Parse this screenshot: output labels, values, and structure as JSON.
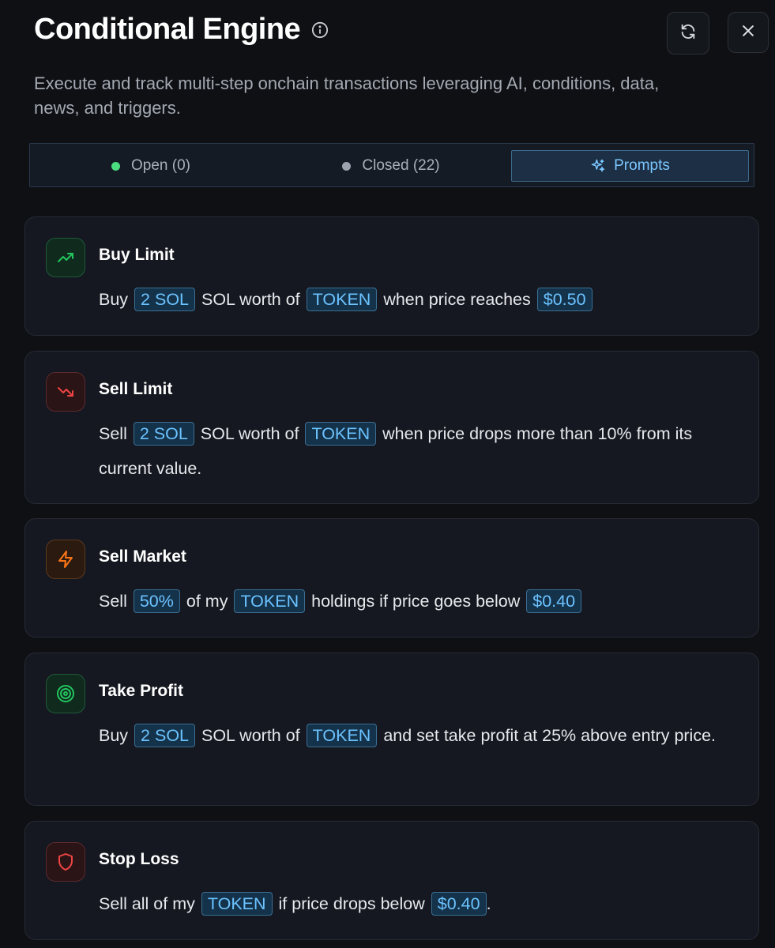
{
  "header": {
    "title": "Conditional Engine",
    "subtitle": "Execute and track multi-step onchain transactions leveraging AI, conditions, data, news, and triggers."
  },
  "tabs": {
    "open": {
      "label": "Open (0)",
      "dot_color": "#4ade80"
    },
    "closed": {
      "label": "Closed (22)",
      "dot_color": "#9ca3af"
    },
    "prompts": {
      "label": "Prompts"
    }
  },
  "colors": {
    "accent": "#6cc3ff",
    "green": "#22c55e",
    "red": "#ef4444",
    "orange": "#f97316"
  },
  "prompts": [
    {
      "title": "Buy Limit",
      "icon": "trending-up-icon",
      "text": {
        "p1": "Buy",
        "v1": "2 SOL",
        "p2": "SOL worth of",
        "v2": "TOKEN",
        "p3": "when price reaches",
        "v3": "$0.50"
      }
    },
    {
      "title": "Sell Limit",
      "icon": "trending-down-icon",
      "text": {
        "p1": "Sell",
        "v1": "2 SOL",
        "p2": "SOL worth of",
        "v2": "TOKEN",
        "p3": "when price drops more than 10% from its current value."
      }
    },
    {
      "title": "Sell Market",
      "icon": "lightning-icon",
      "text": {
        "p1": "Sell",
        "v1": "50%",
        "p2": "of my",
        "v2": "TOKEN",
        "p3": "holdings if price goes below",
        "v3": "$0.40"
      }
    },
    {
      "title": "Take Profit",
      "icon": "target-icon",
      "text": {
        "p1": "Buy",
        "v1": "2 SOL",
        "p2": "SOL worth of",
        "v2": "TOKEN",
        "p3": "and set take profit at 25% above entry price."
      }
    },
    {
      "title": "Stop Loss",
      "icon": "shield-icon",
      "text": {
        "p1": "Sell all of my",
        "v1": "TOKEN",
        "p2": "if price drops below",
        "v2": "$0.40",
        "p3": "."
      }
    }
  ]
}
